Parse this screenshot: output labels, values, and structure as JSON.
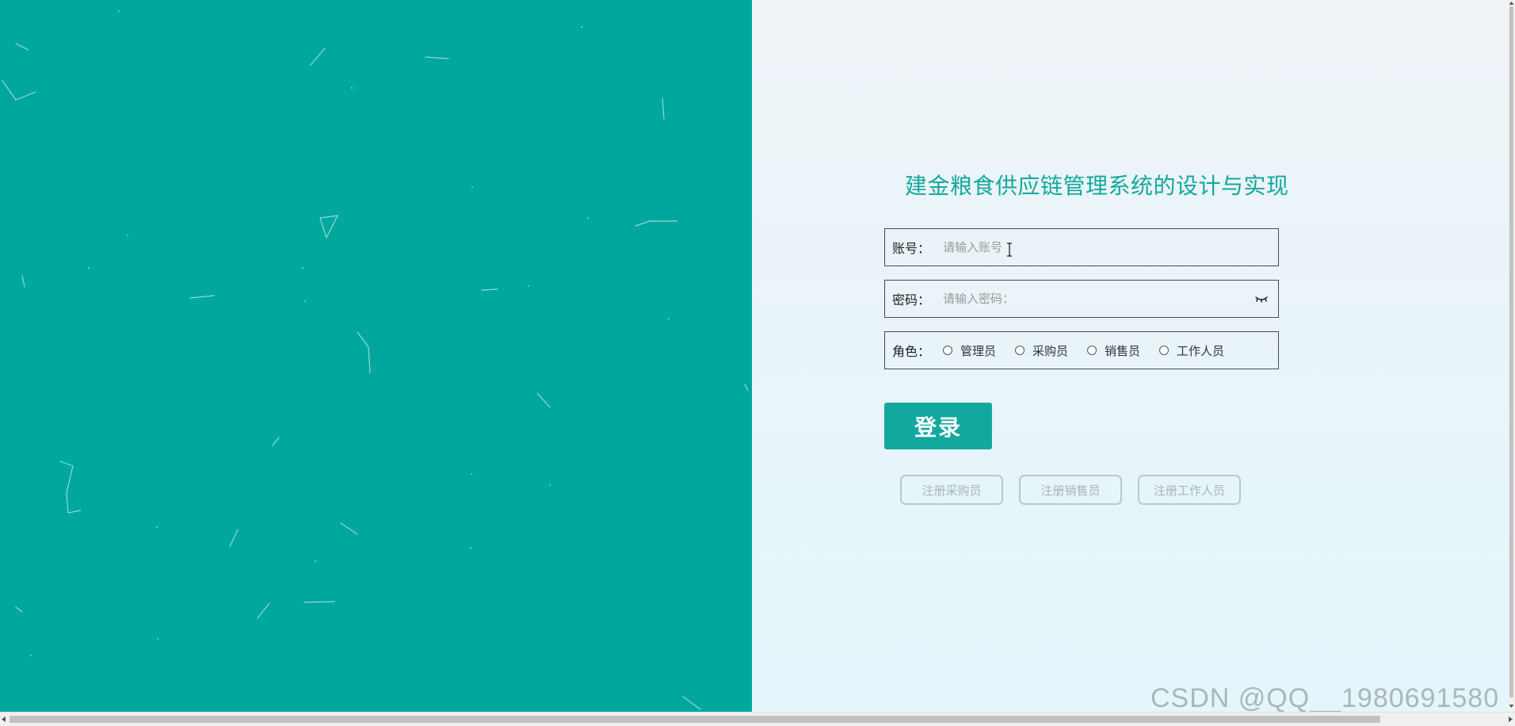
{
  "login": {
    "title": "建金粮食供应链管理系统的设计与实现",
    "account_label": "账号：",
    "account_placeholder": "请输入账号",
    "password_label": "密码：",
    "password_placeholder": "请输入密码：",
    "role_label": "角色：",
    "roles": [
      {
        "label": "管理员"
      },
      {
        "label": "采购员"
      },
      {
        "label": "销售员"
      },
      {
        "label": "工作人员"
      }
    ],
    "login_button": "登录",
    "register_buttons": [
      {
        "label": "注册采购员"
      },
      {
        "label": "注册销售员"
      },
      {
        "label": "注册工作人员"
      }
    ]
  },
  "watermark": "CSDN @QQ__1980691580",
  "icons": {
    "password_toggle": "eye-closed-icon",
    "text_cursor": "text-cursor-icon"
  },
  "colors": {
    "left_panel": "#00a79d",
    "accent": "#13a89e",
    "right_panel_top": "#eef3f7",
    "right_panel_bottom": "#e3f6fb"
  }
}
